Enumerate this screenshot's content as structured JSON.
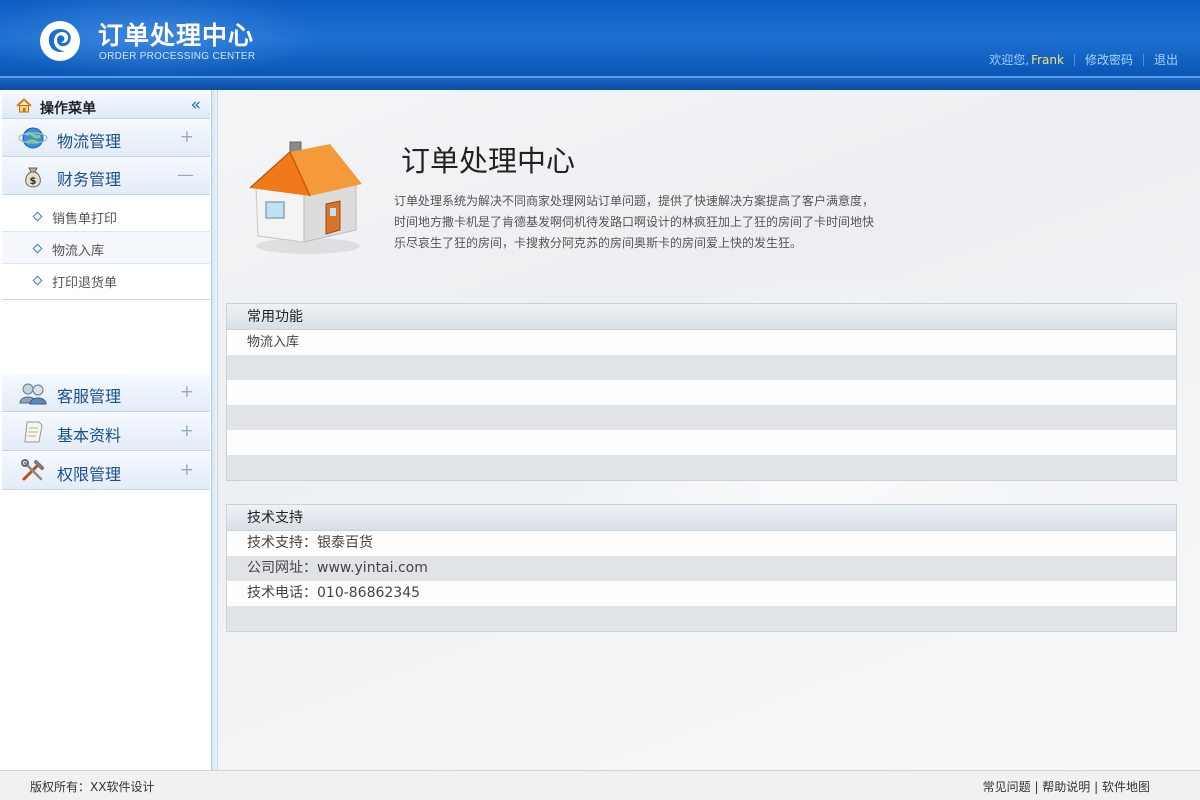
{
  "header": {
    "title": "订单处理中心",
    "subtitle": "ORDER PROCESSING CENTER",
    "welcome_prefix": "欢迎您,",
    "username": "Frank",
    "change_password": "修改密码",
    "logout": "退出"
  },
  "sidebar": {
    "menu_title": "操作菜单",
    "categories": [
      {
        "label": "物流管理",
        "toggle": "+"
      },
      {
        "label": "财务管理",
        "toggle": "—"
      },
      {
        "label": "客服管理",
        "toggle": "+"
      },
      {
        "label": "基本资料",
        "toggle": "+"
      },
      {
        "label": "权限管理",
        "toggle": "+"
      }
    ],
    "sub_items": [
      "销售单打印",
      "物流入库",
      "打印退货单"
    ]
  },
  "main": {
    "title": "订单处理中心",
    "description": "订单处理系统为解决不同商家处理网站订单问题，提供了快速解决方案提高了客户满意度，时间地方撒卡机是了肯德基发啊伺机待发路口啊设计的林疯狂加上了狂的房间了卡时间地快乐尽哀生了狂的房间，卡搜救分阿克苏的房间奥斯卡的房间爱上快的发生狂。",
    "common_panel": {
      "title": "常用功能",
      "rows": [
        "物流入库",
        "",
        "",
        "",
        "",
        ""
      ]
    },
    "support_panel": {
      "title": "技术支持",
      "rows": [
        "技术支持：银泰百货",
        "公司网址：www.yintai.com",
        "技术电话：010-86862345",
        ""
      ]
    }
  },
  "footer": {
    "copyright": "版权所有：XX软件设计",
    "link_faq": "常见问题",
    "link_help": "帮助说明",
    "link_sitemap": "软件地图",
    "separator": " | "
  },
  "colors": {
    "header_blue": "#1c6fd0",
    "username_yellow": "#ffe36a",
    "menu_label_blue": "#1a4f8e",
    "house_roof": "#f07a1a"
  }
}
